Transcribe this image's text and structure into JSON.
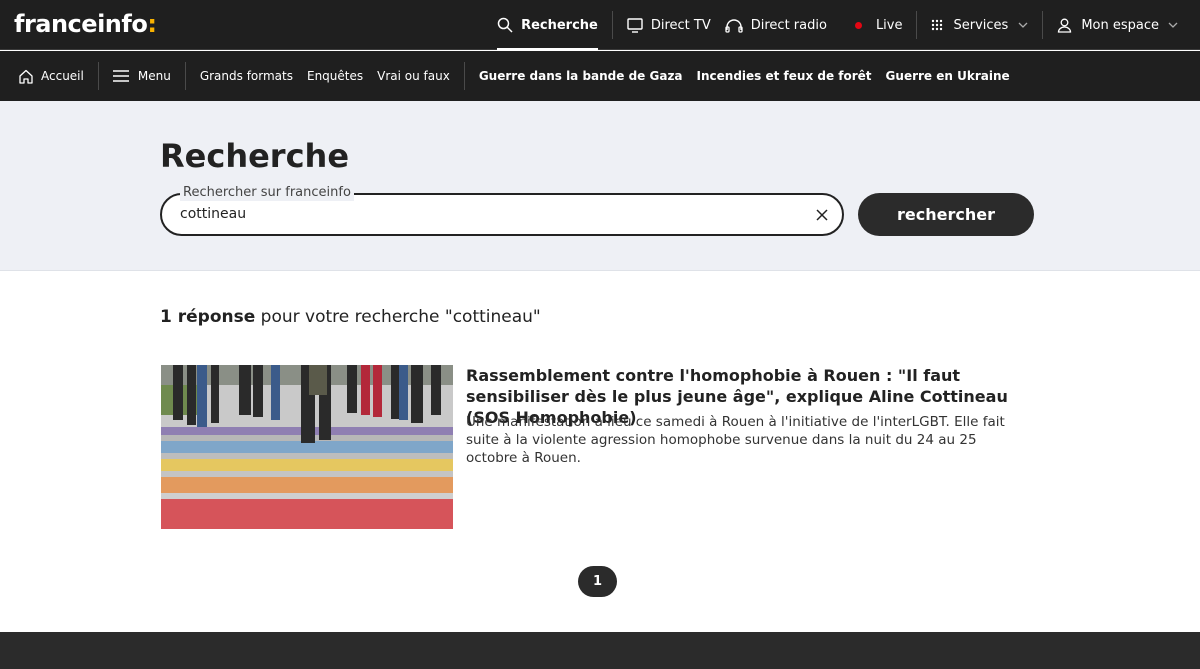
{
  "brand": {
    "logo_text": "franceinfo",
    "logo_colon": ":",
    "accent": "#f9b200"
  },
  "top_nav": {
    "search": "Recherche",
    "direct_tv": "Direct TV",
    "direct_radio": "Direct radio",
    "live": "Live",
    "services": "Services",
    "account": "Mon espace"
  },
  "sub_nav": {
    "home": "Accueil",
    "menu": "Menu",
    "items": [
      "Grands formats",
      "Enquêtes",
      "Vrai ou faux"
    ],
    "topics": [
      "Guerre dans la bande de Gaza",
      "Incendies et feux de forêt",
      "Guerre en Ukraine"
    ]
  },
  "search": {
    "title": "Recherche",
    "label": "Rechercher sur franceinfo",
    "value": "cottineau",
    "button": "rechercher"
  },
  "results": {
    "count_bold": "1 réponse",
    "count_rest": " pour votre recherche \"cottineau\"",
    "items": [
      {
        "title": "Rassemblement contre l'homophobie à Rouen : \"Il faut sensibiliser dès le plus jeune âge\", explique Aline Cottineau (SOS Homophobie)",
        "description": "Une manifestation a lieu ce samedi à Rouen à l'initiative de l'interLGBT. Elle fait suite à la violente agression homophobe survenue dans la nuit du 24 au 25 octobre à Rouen."
      }
    ]
  },
  "pagination": {
    "current": "1"
  },
  "colors": {
    "dark": "#1f1f1f",
    "band": "#eef0f5",
    "live": "#e30613"
  }
}
